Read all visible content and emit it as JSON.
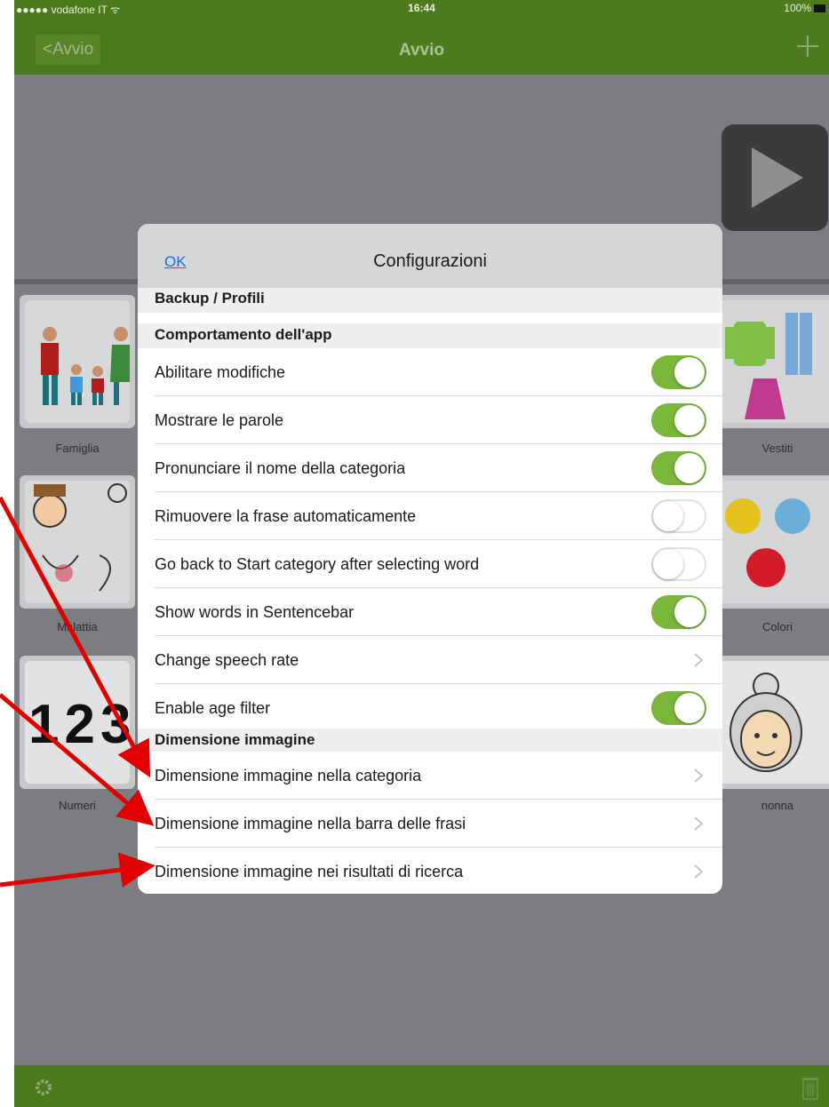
{
  "status_bar": {
    "carrier": "●●●●● vodafone IT ᯤ",
    "time": "16:44",
    "battery": "100%"
  },
  "nav": {
    "back_label": "<Avvio",
    "title": "Avvio",
    "add_icon": "plus-icon"
  },
  "grid": {
    "tiles": [
      {
        "label": "Famiglia"
      },
      {
        "label": "Vestiti"
      },
      {
        "label": "Malattia"
      },
      {
        "label": "Colori"
      },
      {
        "label": "Numeri",
        "art_text": "123"
      },
      {
        "label": "nonna"
      }
    ]
  },
  "modal": {
    "ok_label": "OK",
    "title": "Configurazioni",
    "sections": {
      "backup": "Backup / Profili",
      "behaviour": "Comportamento dell'app",
      "image_size": "Dimensione immagine"
    },
    "rows": [
      {
        "label": "Abilitare modifiche",
        "toggle": true
      },
      {
        "label": "Mostrare le parole",
        "toggle": true
      },
      {
        "label": "Pronunciare il nome della categoria",
        "toggle": true
      },
      {
        "label": "Rimuovere la frase automaticamente",
        "toggle": false
      },
      {
        "label": "Go back to Start category after selecting word",
        "toggle": false
      },
      {
        "label": "Show words in Sentencebar",
        "toggle": true
      },
      {
        "label": "Change speech rate"
      },
      {
        "label": "Enable age filter",
        "toggle": true
      }
    ],
    "image_rows": [
      {
        "label": "Dimensione immagine nella categoria"
      },
      {
        "label": "Dimensione immagine nella barra delle frasi"
      },
      {
        "label": "Dimensione immagine nei risultati di ricerca"
      }
    ]
  },
  "colors": {
    "brand_green": "#4d7a1d",
    "toggle_on": "#79b63a",
    "link_blue": "#1a6fe0",
    "annotation_red": "#e00000"
  },
  "icons": [
    "plus-icon",
    "play-icon",
    "gear-icon",
    "trash-icon",
    "chevron-right-icon",
    "red-arrow"
  ]
}
